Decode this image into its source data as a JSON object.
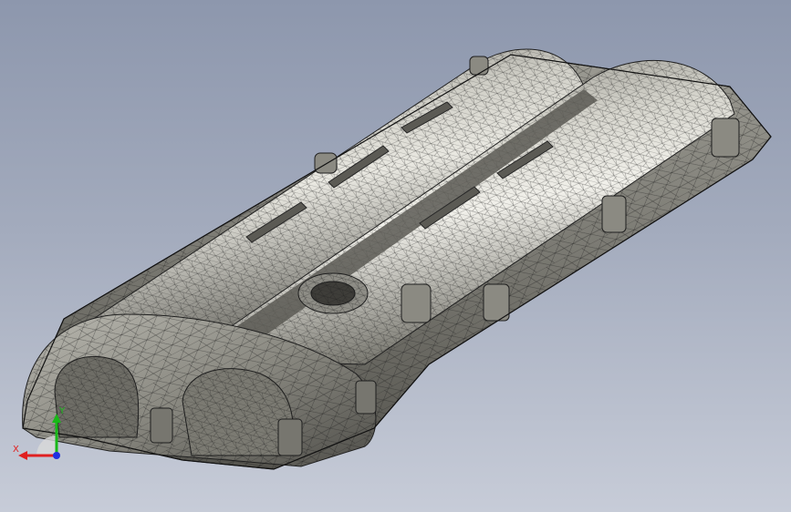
{
  "viewport": {
    "background_top": "#8d97ad",
    "background_bottom": "#c7ccd8",
    "model_fill": "#9b9a92",
    "model_shadow": "#5f5e58",
    "model_highlight": "#e4e3dc",
    "mesh_color": "#1c1c1c"
  },
  "triad": {
    "x_label": "X",
    "y_label": "Y",
    "x_color": "#e02020",
    "y_color": "#18b818",
    "z_color": "#2030e0"
  }
}
